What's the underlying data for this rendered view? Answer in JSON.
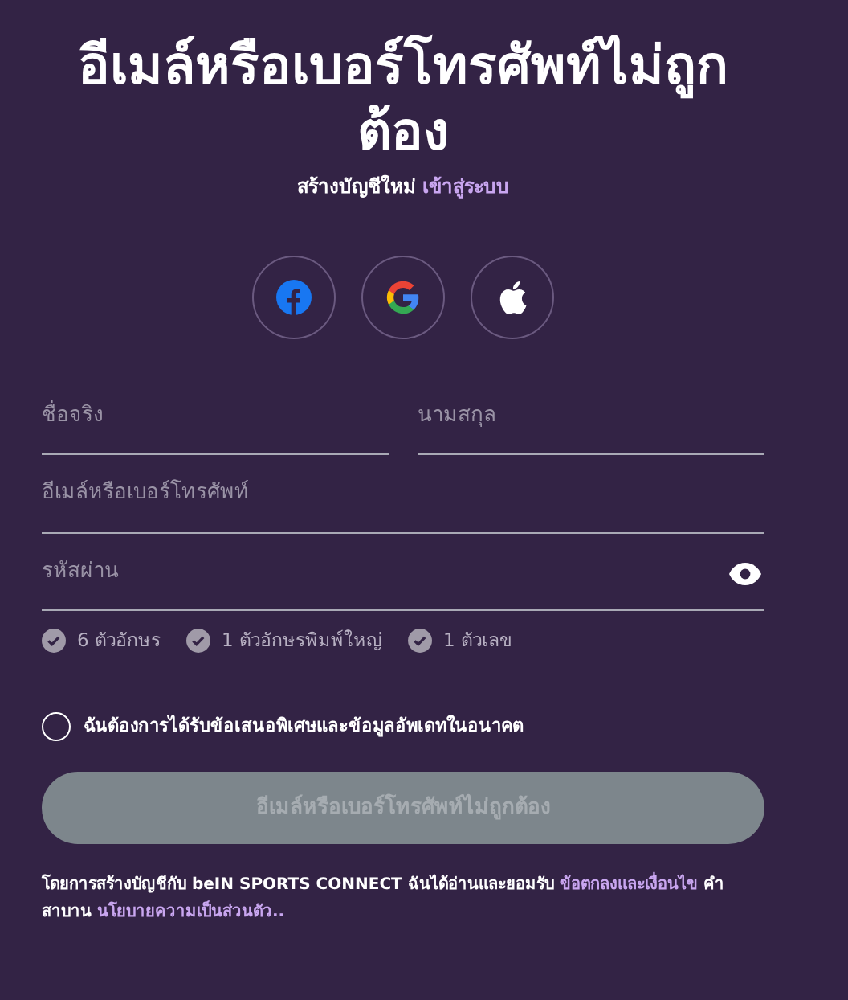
{
  "title": "อีเมล์หรือเบอร์โทรศัพท์ไม่ถูกต้อง",
  "subtitle": {
    "text": "สร้างบัญชีใหม่",
    "link": "เข้าสู่ระบบ"
  },
  "social_buttons": [
    {
      "kind": "facebook"
    },
    {
      "kind": "google"
    },
    {
      "kind": "apple"
    }
  ],
  "name_fields": [
    {
      "placeholder": "ชื่อจริง"
    },
    {
      "placeholder": "นามสกุล"
    }
  ],
  "fields": [
    {
      "placeholder": "อีเมล์หรือเบอร์โทรศัพท์",
      "kind": "text"
    },
    {
      "placeholder": "รหัสผ่าน",
      "kind": "password"
    }
  ],
  "password_rules": [
    {
      "label": "6 ตัวอักษร",
      "met": false
    },
    {
      "label": "1 ตัวอักษรพิมพ์ใหญ่",
      "met": false
    },
    {
      "label": "1 ตัวเลข",
      "met": false
    }
  ],
  "newsletter": {
    "label": "ฉันต้องการได้รับข้อเสนอพิเศษและข้อมูลอัพเดทในอนาคต",
    "checked": false
  },
  "submit": {
    "label": "อีเมล์หรือเบอร์โทรศัพท์ไม่ถูกต้อง",
    "disabled": true
  },
  "terms": {
    "text_1": "โดยการสร้างบัญชีกับ beIN SPORTS CONNECT ฉันได้อ่านและยอมรับ",
    "terms_link": "ข้อตกลงและเงื่อนไข",
    "text_2": "คำสาบาน",
    "privacy_link": "นโยบายความเป็นส่วนตัว.."
  }
}
